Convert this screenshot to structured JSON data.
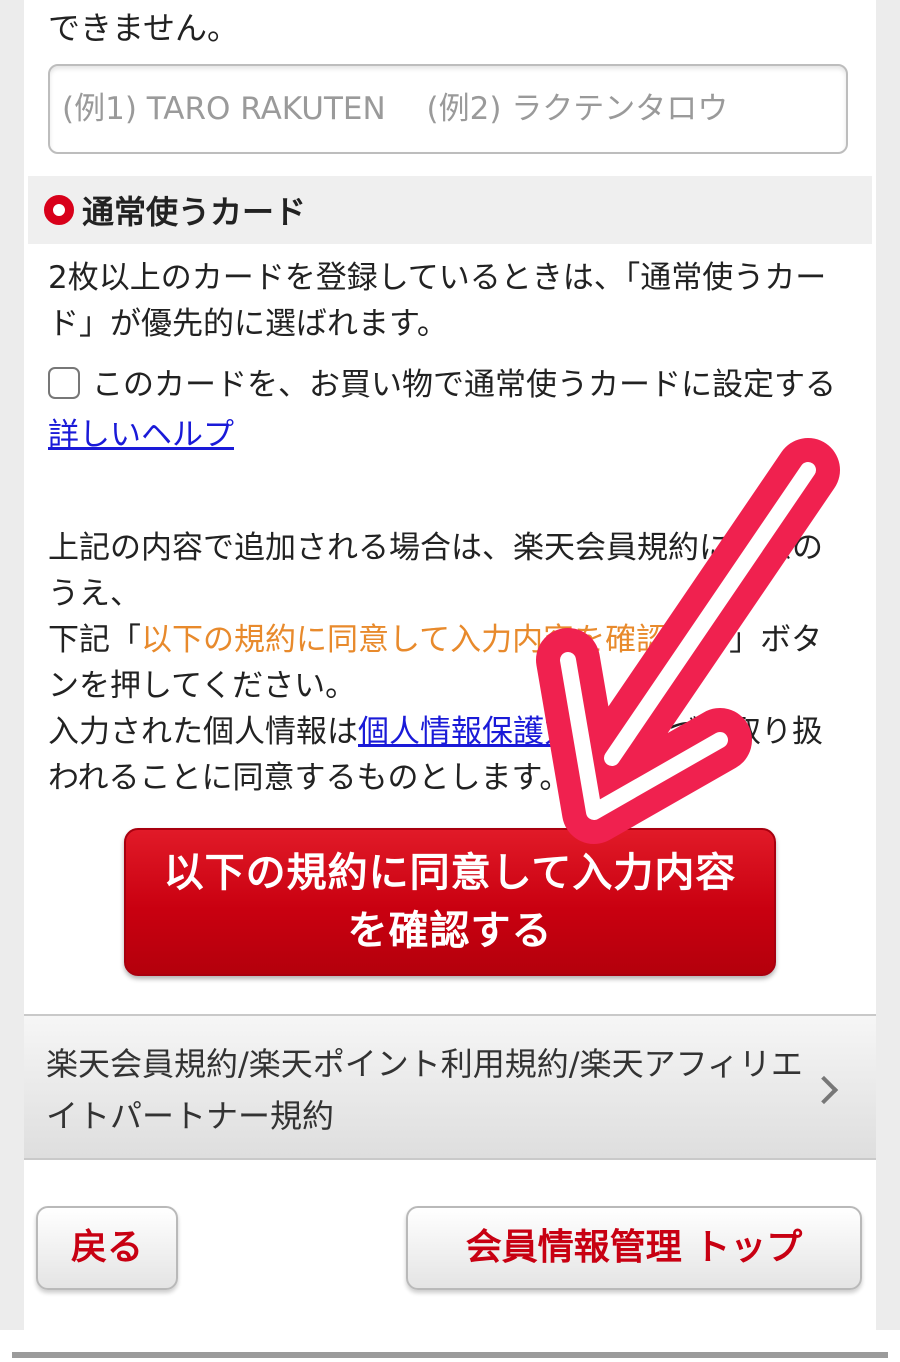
{
  "top_text": "できません。",
  "name_input": {
    "value": "",
    "placeholder": "(例1) TARO RAKUTEN　 (例2) ラクテンタロウ"
  },
  "default_card": {
    "title": "通常使うカード",
    "description": "2枚以上のカードを登録しているときは、「通常使うカード」が優先的に選ばれます。",
    "checkbox_label": "このカードを、お買い物で通常使うカードに設定する",
    "help_link": "詳しいヘルプ"
  },
  "notice": {
    "line1": "上記の内容で追加される場合は、楽天会員規約に同意のうえ、",
    "line2_prefix": "下記「",
    "line2_highlight": "以下の規約に同意して入力内容を確認する",
    "line2_suffix": "」ボタンを押してください。",
    "line3_prefix": "入力された個人情報は",
    "privacy_link": "個人情報保護方針",
    "line3_suffix": "に基づき取り扱われることに同意するものとします。"
  },
  "confirm_button": {
    "line1": "以下の規約に同意して入力内容",
    "line2": "を確認する"
  },
  "terms_link": "楽天会員規約/楽天ポイント利用規約/楽天アフィリエイトパートナー規約",
  "back_button": "戻る",
  "member_top_button": "会員情報管理 トップ",
  "colors": {
    "brand_red": "#c90010",
    "highlight_orange": "#e88a2c",
    "link_blue": "#1a1ad8",
    "arrow_pink": "#f0214f"
  },
  "icons": [
    "radio-selected-icon",
    "checkbox-icon",
    "chevron-right-icon",
    "arrow-annotation-icon"
  ]
}
